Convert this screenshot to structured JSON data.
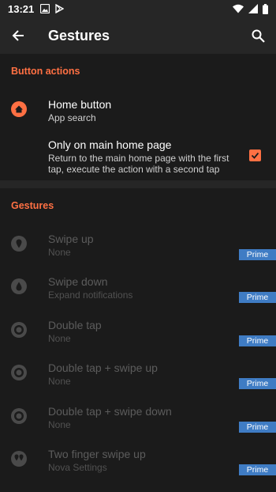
{
  "status_bar": {
    "time": "13:21"
  },
  "app_bar": {
    "title": "Gestures"
  },
  "button_actions": {
    "header": "Button actions",
    "home_button": {
      "title": "Home button",
      "subtitle": "App search"
    },
    "only_main": {
      "title": "Only on main home page",
      "subtitle_line1": "Return to the main home page with the first",
      "subtitle_line2": "tap, execute the action with a second tap",
      "checked": true
    }
  },
  "gestures": {
    "header": "Gestures",
    "items": [
      {
        "title": "Swipe up",
        "subtitle": "None",
        "badge": "Prime",
        "icon": "swipe-up-icon"
      },
      {
        "title": "Swipe down",
        "subtitle": "Expand notifications",
        "badge": "Prime",
        "icon": "swipe-down-icon"
      },
      {
        "title": "Double tap",
        "subtitle": "None",
        "badge": "Prime",
        "icon": "double-tap-icon"
      },
      {
        "title": "Double tap + swipe up",
        "subtitle": "None",
        "badge": "Prime",
        "icon": "double-tap-swipe-up-icon"
      },
      {
        "title": "Double tap + swipe down",
        "subtitle": "None",
        "badge": "Prime",
        "icon": "double-tap-swipe-down-icon"
      },
      {
        "title": "Two finger swipe up",
        "subtitle": "Nova Settings",
        "badge": "Prime",
        "icon": "two-finger-swipe-up-icon"
      }
    ]
  },
  "colors": {
    "accent": "#ff7043",
    "prime": "#3f7cc4",
    "background": "#1b1b1b",
    "toolbar": "#262626"
  }
}
